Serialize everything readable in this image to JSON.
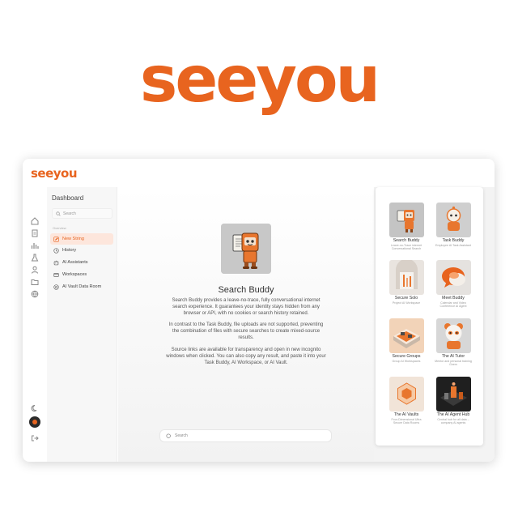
{
  "brand": {
    "hero_logo": "seeyou",
    "app_logo": "seeyou",
    "accent": "#e8641f"
  },
  "rail_icons": [
    "home-icon",
    "document-icon",
    "chart-icon",
    "flask-icon",
    "user-icon",
    "folder-icon",
    "globe-icon",
    "moon-icon",
    "orange-circle-icon",
    "logout-icon"
  ],
  "sidebar": {
    "title": "Dashboard",
    "search_placeholder": "Search",
    "section": "Overview",
    "items": [
      {
        "label": "New String",
        "icon": "edit-icon",
        "active": true
      },
      {
        "label": "History",
        "icon": "clock-icon"
      },
      {
        "label": "AI Assistants",
        "icon": "assistant-icon"
      },
      {
        "label": "Workspaces",
        "icon": "workspace-icon"
      },
      {
        "label": "AI Vault Data Room",
        "icon": "vault-icon"
      }
    ]
  },
  "main": {
    "title": "Search Buddy",
    "paragraphs": [
      "Search Buddy provides a leave-no-trace, fully conversational internet search experience. It guarantees your identity stays hidden from any browser or API, with no cookies or search history retained.",
      "In contrast to the Task Buddy, file uploads are not supported, preventing the combination of files with secure searches to create mixed-source results.",
      "Source links are available for transparency and open in new incognito windows when clicked. You can also copy any result, and paste it into your Task Buddy, AI Workspace, or AI Vault."
    ],
    "search_placeholder": "Search"
  },
  "cards": [
    {
      "name": "Search Buddy",
      "sub": "Leave-no-Trace internet Conversational Search"
    },
    {
      "name": "Task Buddy",
      "sub": "Employee AI Task Assistant"
    },
    {
      "name": "Secure Solo",
      "sub": "Project AI Workspace"
    },
    {
      "name": "Meet Buddy",
      "sub": "Calendar and Video Conference AI Agent"
    },
    {
      "name": "Secure Groups",
      "sub": "Group AI Workspaces"
    },
    {
      "name": "The AI Tutor",
      "sub": "Mentor and personal training Gnem"
    },
    {
      "name": "The AI Vaults",
      "sub": "Four-Dimensional Ultra Secure Data Rooms"
    },
    {
      "name": "The AI Agent Hub",
      "sub": "Central hub for all data – company AI agents"
    }
  ]
}
